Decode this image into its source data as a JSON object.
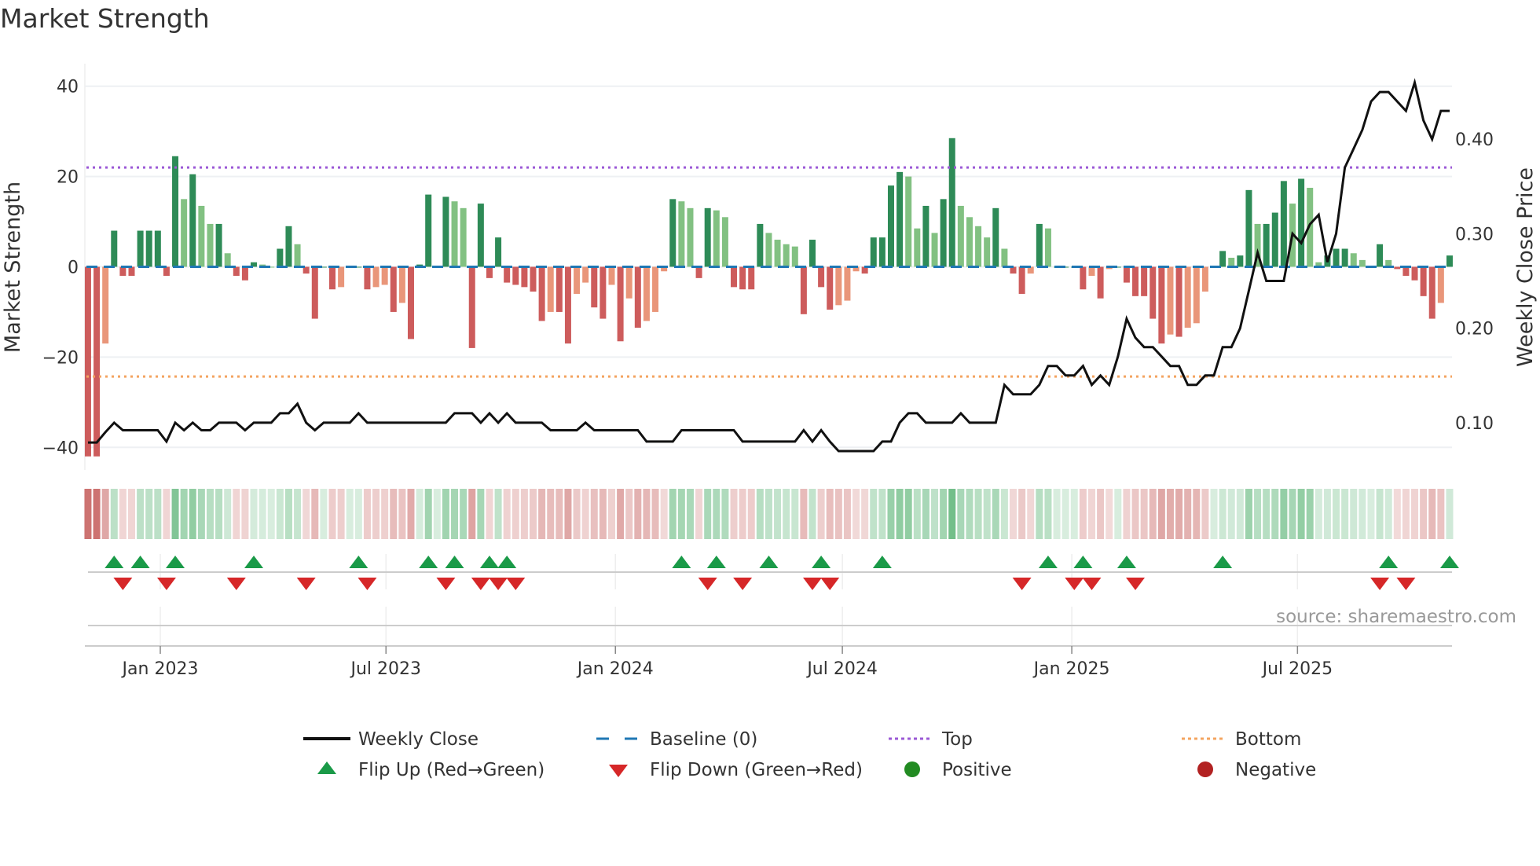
{
  "title": "Market Strength",
  "source": "source: sharemaestro.com",
  "colors": {
    "strong_positive": "#2e8b57",
    "weak_positive": "#82c182",
    "strong_negative": "#cd5c5c",
    "weak_negative": "#e9967a",
    "top_line": "#9b59d6",
    "bottom_line": "#f4a460",
    "baseline": "#1f77b4",
    "close_line": "#111111",
    "flip_up": "#1a9a48",
    "flip_down": "#d62728",
    "positive": "#228b22",
    "negative": "#b22222"
  },
  "chart_data": {
    "type": "bar+line",
    "frequency": "weekly",
    "start_date": "2022-11-04",
    "ylabel": "Market Strength",
    "y2label": "Weekly Close Price",
    "ylim": [
      -45,
      45
    ],
    "y2lim": [
      0.05,
      0.48
    ],
    "yticks": [
      {
        "value": 40,
        "label": "40"
      },
      {
        "value": 20,
        "label": "20"
      },
      {
        "value": 0,
        "label": "0"
      },
      {
        "value": -20,
        "label": "−20"
      },
      {
        "value": -40,
        "label": "−40"
      }
    ],
    "y2ticks": [
      {
        "value": 0.4,
        "label": "0.40"
      },
      {
        "value": 0.3,
        "label": "0.30"
      },
      {
        "value": 0.2,
        "label": "0.20"
      },
      {
        "value": 0.1,
        "label": "0.10"
      }
    ],
    "xticks": [
      {
        "date": "2023-01-01",
        "label": "Jan 2023"
      },
      {
        "date": "2023-07-01",
        "label": "Jul 2023"
      },
      {
        "date": "2024-01-01",
        "label": "Jan 2024"
      },
      {
        "date": "2024-07-01",
        "label": "Jul 2024"
      },
      {
        "date": "2025-01-01",
        "label": "Jan 2025"
      },
      {
        "date": "2025-07-01",
        "label": "Jul 2025"
      }
    ],
    "grid": true,
    "top_level": 22,
    "bottom_level": -24.3,
    "baseline": 0,
    "strength": [
      -42,
      -42,
      -17,
      8,
      -2,
      -2,
      8,
      8,
      8,
      -2,
      24.5,
      15,
      20.5,
      13.5,
      9.5,
      9.5,
      3,
      -2,
      -3,
      1,
      0.5,
      0,
      4,
      9,
      5,
      -1.5,
      -11.5,
      0,
      -5,
      -4.5,
      0,
      0,
      -5,
      -4.5,
      -4,
      -10,
      -8,
      -16,
      0.5,
      16,
      0,
      15.5,
      14.5,
      13,
      -18,
      14,
      -2.5,
      6.5,
      -3.5,
      -4,
      -4.5,
      -5.5,
      -12,
      -10,
      -10,
      -17,
      -6,
      -3.5,
      -9,
      -11.5,
      -4,
      -16.5,
      -7,
      -13.5,
      -12,
      -10,
      -1,
      15,
      14.5,
      13,
      -2.5,
      13,
      12.5,
      11,
      -4.5,
      -5,
      -5,
      9.5,
      7.5,
      6,
      5,
      4.5,
      -10.5,
      6,
      -4.5,
      -9.5,
      -8.5,
      -7.5,
      -1,
      -1.5,
      6.5,
      6.5,
      18,
      21,
      20,
      8.5,
      13.5,
      7.5,
      15,
      28.5,
      13.5,
      11,
      9,
      6.5,
      13,
      4,
      -1.5,
      -6,
      -1.5,
      9.5,
      8.5,
      0,
      0,
      0,
      -5,
      -2,
      -7,
      -0.5,
      0,
      -3.5,
      -6.5,
      -6.5,
      -11.5,
      -17,
      -15,
      -15.5,
      -13.5,
      -12.5,
      -5.5,
      0,
      3.5,
      2,
      2.5,
      17,
      9.5,
      9.5,
      12,
      19,
      14,
      19.5,
      17.5,
      1,
      2.5,
      4,
      4,
      3,
      1.5,
      0,
      5,
      1.5,
      -0.5,
      -2,
      -3,
      -6.5,
      -11.5,
      -8,
      2.5
    ],
    "weekly_close": [
      0.079,
      0.079,
      0.09,
      0.1,
      0.092,
      0.092,
      0.092,
      0.092,
      0.092,
      0.08,
      0.1,
      0.092,
      0.1,
      0.092,
      0.092,
      0.1,
      0.1,
      0.1,
      0.092,
      0.1,
      0.1,
      0.1,
      0.11,
      0.11,
      0.12,
      0.1,
      0.092,
      0.1,
      0.1,
      0.1,
      0.1,
      0.11,
      0.1,
      0.1,
      0.1,
      0.1,
      0.1,
      0.1,
      0.1,
      0.1,
      0.1,
      0.1,
      0.11,
      0.11,
      0.11,
      0.1,
      0.11,
      0.1,
      0.11,
      0.1,
      0.1,
      0.1,
      0.1,
      0.092,
      0.092,
      0.092,
      0.092,
      0.1,
      0.092,
      0.092,
      0.092,
      0.092,
      0.092,
      0.092,
      0.08,
      0.08,
      0.08,
      0.08,
      0.092,
      0.092,
      0.092,
      0.092,
      0.092,
      0.092,
      0.092,
      0.08,
      0.08,
      0.08,
      0.08,
      0.08,
      0.08,
      0.08,
      0.092,
      0.08,
      0.092,
      0.08,
      0.07,
      0.07,
      0.07,
      0.07,
      0.07,
      0.08,
      0.08,
      0.1,
      0.11,
      0.11,
      0.1,
      0.1,
      0.1,
      0.1,
      0.11,
      0.1,
      0.1,
      0.1,
      0.1,
      0.14,
      0.13,
      0.13,
      0.13,
      0.14,
      0.16,
      0.16,
      0.15,
      0.15,
      0.16,
      0.14,
      0.15,
      0.14,
      0.17,
      0.21,
      0.19,
      0.18,
      0.18,
      0.17,
      0.16,
      0.16,
      0.14,
      0.14,
      0.15,
      0.15,
      0.18,
      0.18,
      0.2,
      0.24,
      0.28,
      0.25,
      0.25,
      0.25,
      0.3,
      0.29,
      0.31,
      0.32,
      0.27,
      0.3,
      0.37,
      0.39,
      0.41,
      0.44,
      0.45,
      0.45,
      0.44,
      0.43,
      0.46,
      0.42,
      0.4,
      0.43,
      0.43
    ],
    "flip_up_dates": [
      "2022-11-25",
      "2022-12-16",
      "2023-01-13",
      "2023-03-17",
      "2023-06-09",
      "2023-08-04",
      "2023-08-25",
      "2023-09-22",
      "2023-10-06",
      "2024-02-23",
      "2024-03-22",
      "2024-05-03",
      "2024-06-14",
      "2024-08-02",
      "2024-12-13",
      "2025-01-10",
      "2025-02-14",
      "2025-05-02",
      "2025-09-12",
      "2025-10-31"
    ],
    "flip_down_dates": [
      "2022-12-02",
      "2023-01-06",
      "2023-03-03",
      "2023-04-28",
      "2023-06-16",
      "2023-08-18",
      "2023-09-15",
      "2023-09-29",
      "2023-10-13",
      "2024-03-15",
      "2024-04-12",
      "2024-06-07",
      "2024-06-21",
      "2024-11-22",
      "2025-01-03",
      "2025-01-17",
      "2025-02-21",
      "2025-09-05",
      "2025-09-26"
    ],
    "legend": [
      {
        "key": "close",
        "label": "Weekly Close"
      },
      {
        "key": "baseline",
        "label": "Baseline (0)"
      },
      {
        "key": "top",
        "label": "Top"
      },
      {
        "key": "bottom",
        "label": "Bottom"
      },
      {
        "key": "flip_up",
        "label": "Flip Up (Red→Green)"
      },
      {
        "key": "flip_down",
        "label": "Flip Down (Green→Red)"
      },
      {
        "key": "positive",
        "label": "Positive"
      },
      {
        "key": "negative",
        "label": "Negative"
      }
    ],
    "legend_position": "bottom"
  }
}
